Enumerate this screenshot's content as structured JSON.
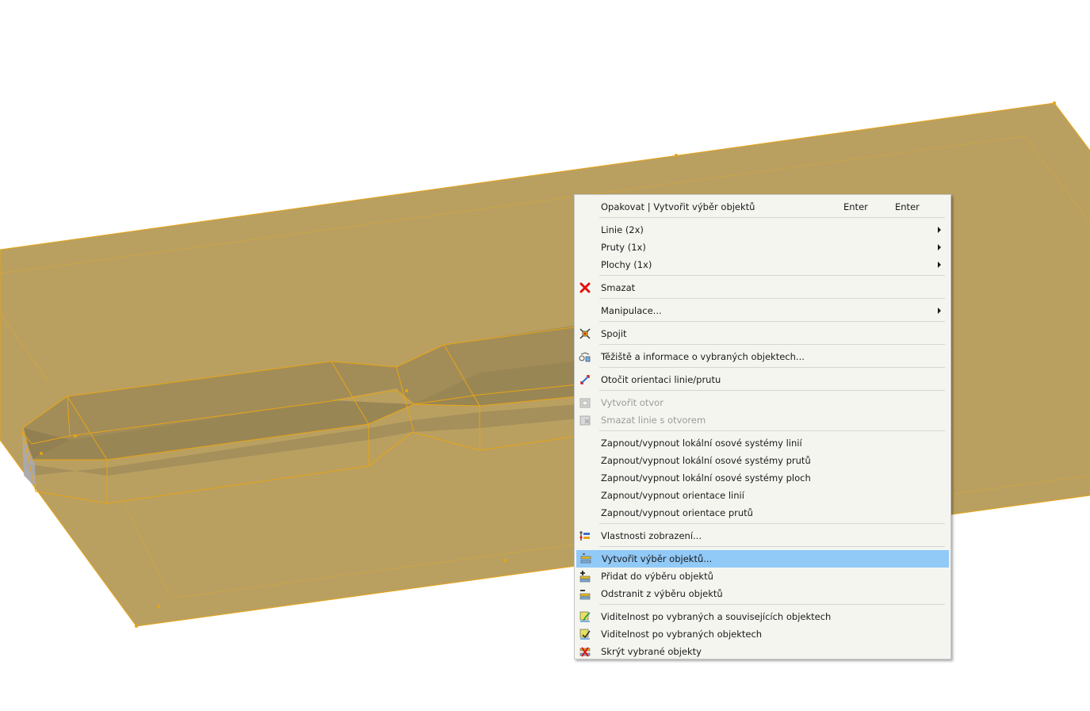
{
  "viewport": {
    "model": "3d-structure-view",
    "fill_color": "#b9a061",
    "line_color": "#e8a414"
  },
  "menu": {
    "items": [
      {
        "label": "Opakovat | Vytvořit výběr objektů",
        "shortcut1": "Enter",
        "shortcut2": "Enter"
      },
      {
        "label": "Linie (2x)"
      },
      {
        "label": "Pruty (1x)"
      },
      {
        "label": "Plochy (1x)"
      },
      {
        "label": "Smazat",
        "icon": "delete-icon"
      },
      {
        "label": "Manipulace..."
      },
      {
        "label": "Spojit",
        "icon": "connect-icon"
      },
      {
        "label": "Těžiště a informace o vybraných objektech...",
        "icon": "centroid-info-icon"
      },
      {
        "label": "Otočit orientaci linie/prutu",
        "icon": "reverse-orientation-icon"
      },
      {
        "label": "Vytvořit otvor",
        "icon": "create-opening-icon",
        "disabled": true
      },
      {
        "label": "Smazat linie s otvorem",
        "icon": "delete-lines-opening-icon",
        "disabled": true
      },
      {
        "label": "Zapnout/vypnout lokální osové systémy linií"
      },
      {
        "label": "Zapnout/vypnout lokální osové systémy prutů"
      },
      {
        "label": "Zapnout/vypnout lokální osové systémy ploch"
      },
      {
        "label": "Zapnout/vypnout orientace linií"
      },
      {
        "label": "Zapnout/vypnout orientace prutů"
      },
      {
        "label": "Vlastnosti zobrazení...",
        "icon": "display-properties-icon"
      },
      {
        "label": "Vytvořit výběr objektů...",
        "icon": "create-selection-icon",
        "highlighted": true
      },
      {
        "label": "Přidat do výběru objektů",
        "icon": "add-to-selection-icon"
      },
      {
        "label": "Odstranit z výběru objektů",
        "icon": "remove-from-selection-icon"
      },
      {
        "label": "Viditelnost po vybraných a souvisejících objektech",
        "icon": "visibility-related-icon"
      },
      {
        "label": "Viditelnost po vybraných objektech",
        "icon": "visibility-selected-icon"
      },
      {
        "label": "Skrýt vybrané objekty",
        "icon": "hide-selected-icon"
      }
    ]
  }
}
